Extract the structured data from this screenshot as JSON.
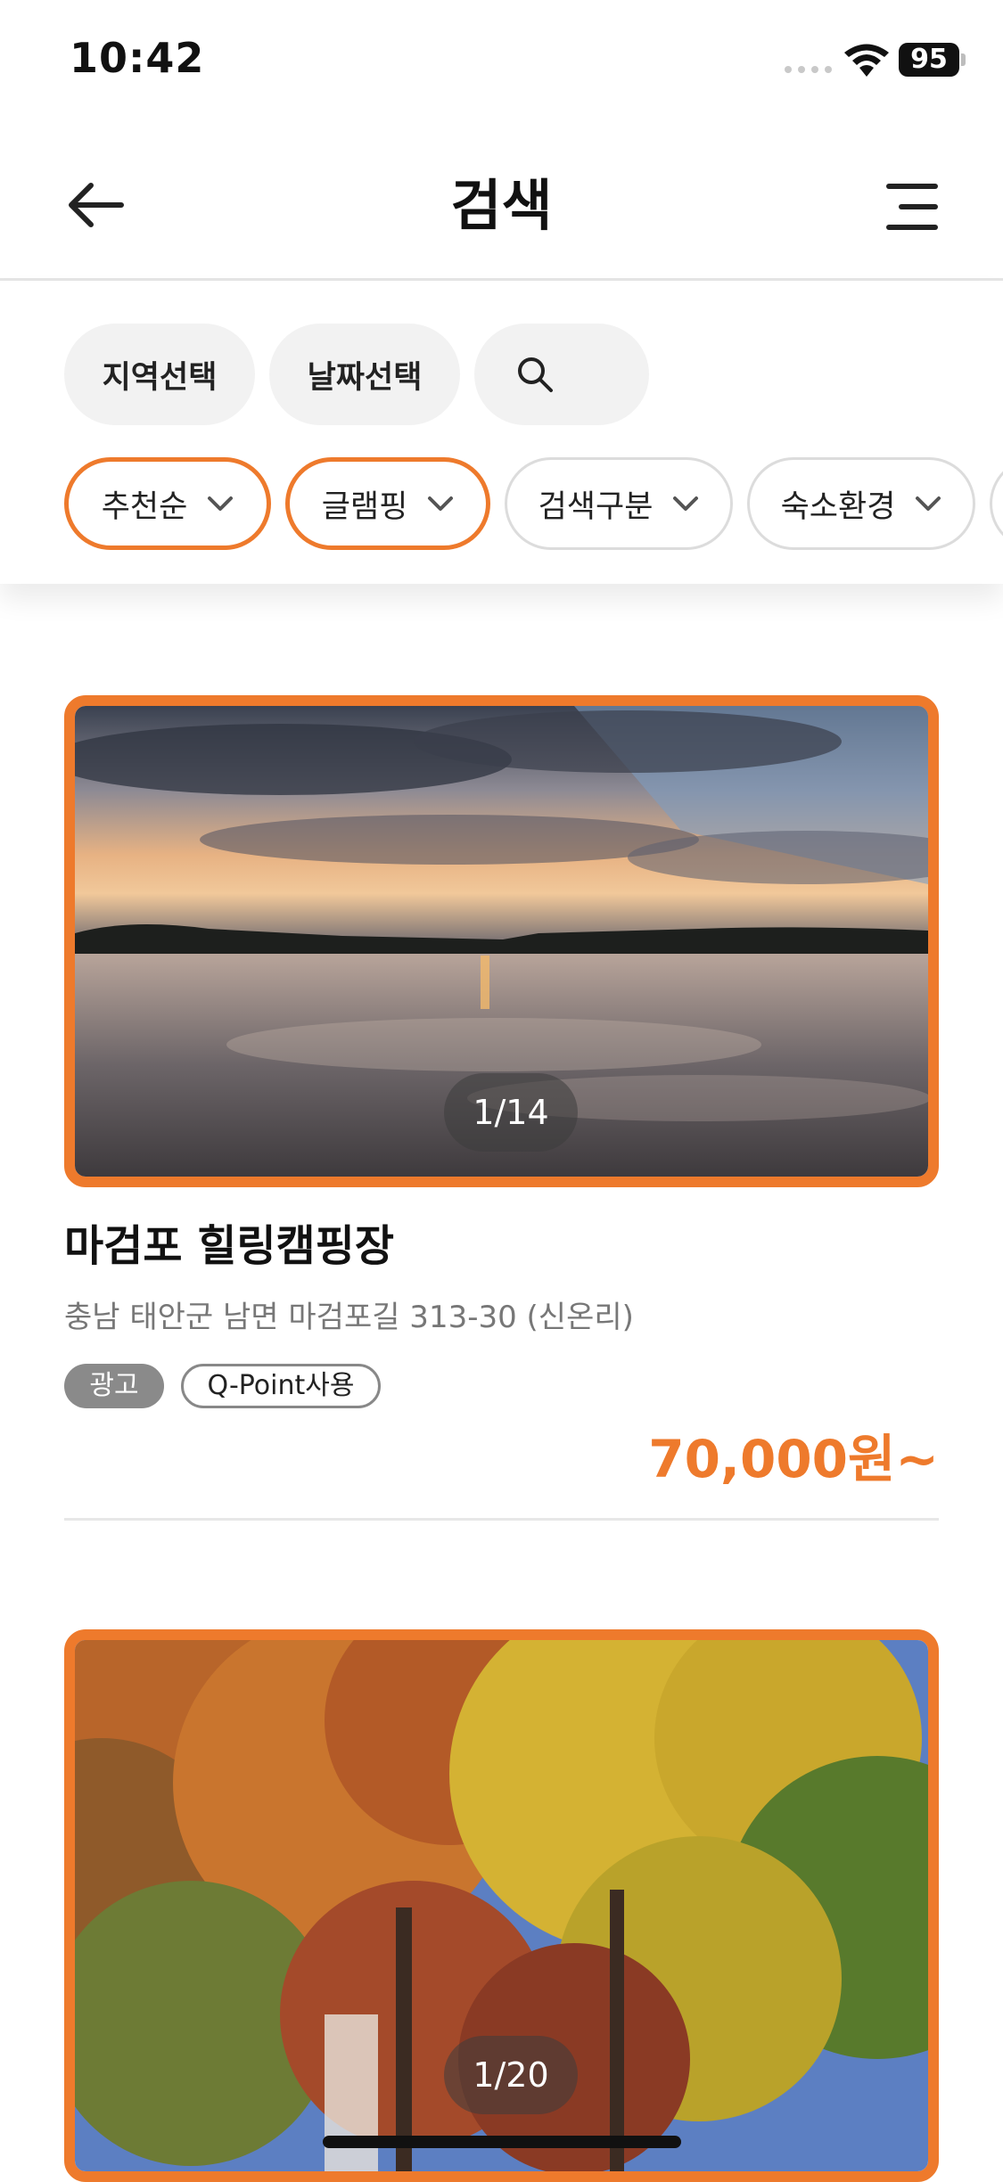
{
  "status_bar": {
    "time": "10:42",
    "battery": "95"
  },
  "header": {
    "title": "검색"
  },
  "quick_filters": [
    {
      "label": "지역선택"
    },
    {
      "label": "날짜선택"
    }
  ],
  "sort_filters": [
    {
      "label": "추천순",
      "active": true
    },
    {
      "label": "글램핑",
      "active": true
    },
    {
      "label": "검색구분",
      "active": false
    },
    {
      "label": "숙소환경",
      "active": false
    }
  ],
  "listings": [
    {
      "name": "마검포 힐링캠핑장",
      "address": "충남 태안군 남면 마검포길 313-30 (신온리)",
      "tags": [
        "광고",
        "Q-Point사용"
      ],
      "price": "70,000원~",
      "photo_counter": "1/14"
    },
    {
      "photo_counter": "1/20"
    }
  ],
  "colors": {
    "accent": "#ee7a2c",
    "chip_bg": "#f2f2f2",
    "text": "#111111",
    "muted": "#777777"
  }
}
